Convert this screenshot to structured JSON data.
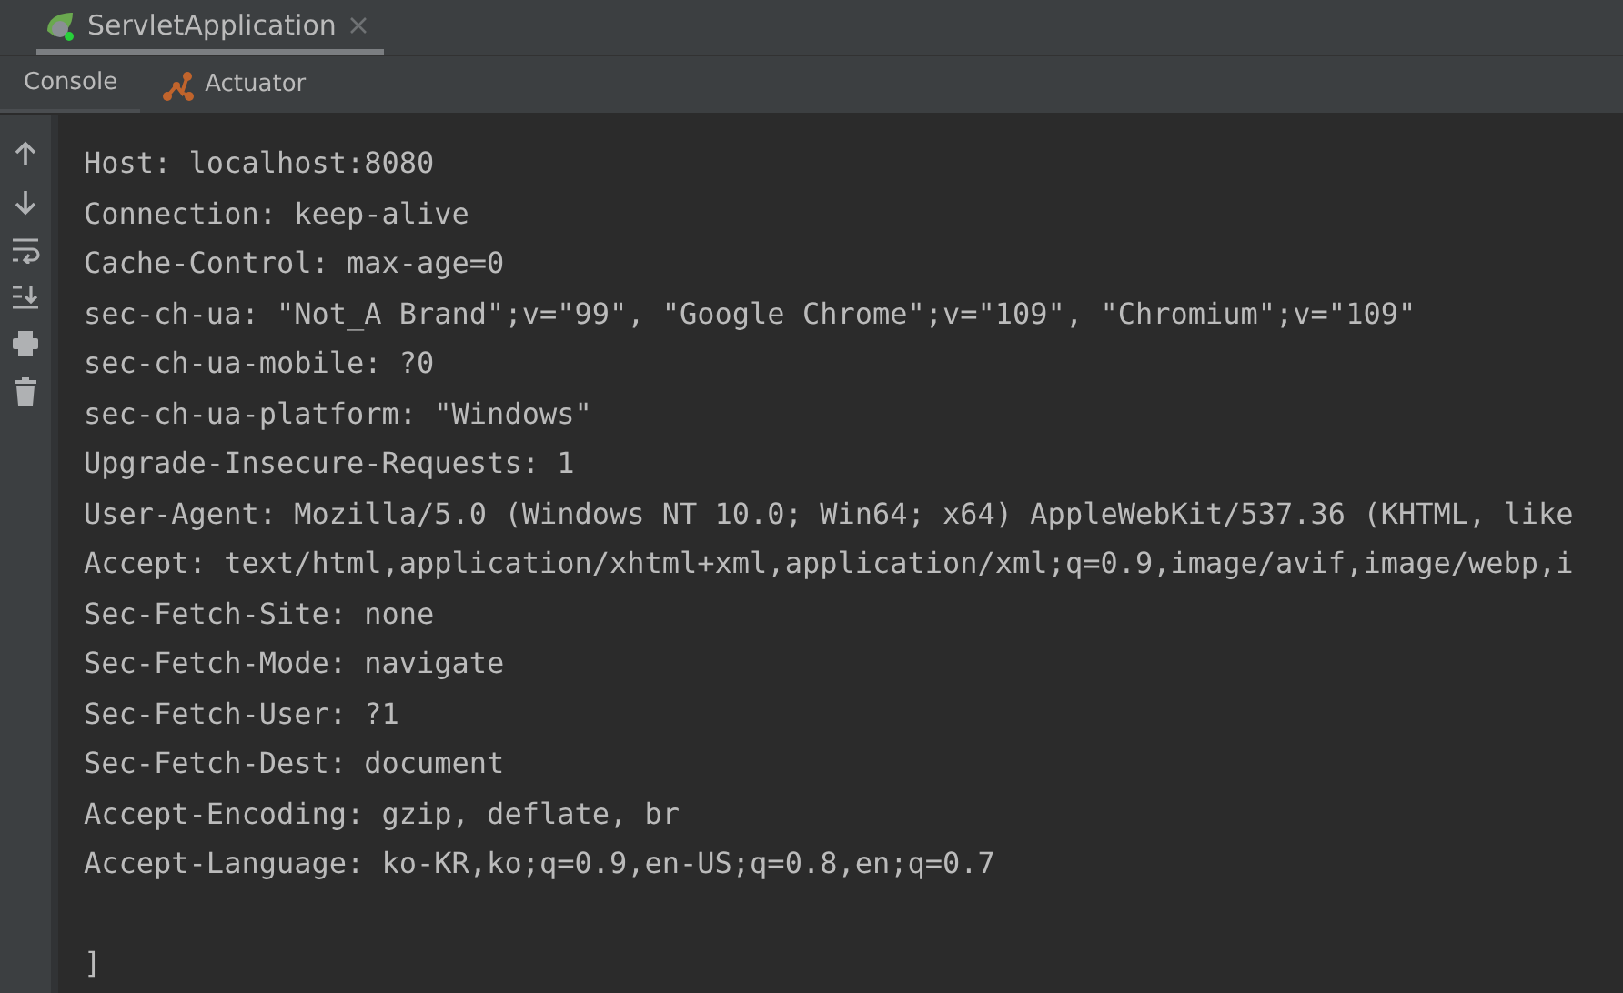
{
  "tabs": [
    {
      "label": "ServletApplication",
      "selected": true
    }
  ],
  "tool_tabs": [
    {
      "label": "Console",
      "selected": true,
      "kind": "console"
    },
    {
      "label": "Actuator",
      "selected": false,
      "kind": "actuator"
    }
  ],
  "toolbar": [
    {
      "kind": "up"
    },
    {
      "kind": "down"
    },
    {
      "kind": "wrap"
    },
    {
      "kind": "scroll-end"
    },
    {
      "kind": "print"
    },
    {
      "kind": "trash"
    }
  ],
  "console_lines": [
    {
      "text": "Host: localhost:8080"
    },
    {
      "text": "Connection: keep-alive"
    },
    {
      "text": "Cache-Control: max-age=0"
    },
    {
      "text": "sec-ch-ua: \"Not_A Brand\";v=\"99\", \"Google Chrome\";v=\"109\", \"Chromium\";v=\"109\""
    },
    {
      "text": "sec-ch-ua-mobile: ?0"
    },
    {
      "text": "sec-ch-ua-platform: \"Windows\""
    },
    {
      "text": "Upgrade-Insecure-Requests: 1"
    },
    {
      "text": "User-Agent: Mozilla/5.0 (Windows NT 10.0; Win64; x64) AppleWebKit/537.36 (KHTML, like"
    },
    {
      "text": "Accept: text/html,application/xhtml+xml,application/xml;q=0.9,image/avif,image/webp,i"
    },
    {
      "text": "Sec-Fetch-Site: none"
    },
    {
      "text": "Sec-Fetch-Mode: navigate"
    },
    {
      "text": "Sec-Fetch-User: ?1"
    },
    {
      "text": "Sec-Fetch-Dest: document"
    },
    {
      "text": "Accept-Encoding: gzip, deflate, br"
    },
    {
      "text": "Accept-Language: ko-KR,ko;q=0.9,en-US;q=0.8,en;q=0.7"
    },
    {
      "text": "]",
      "gap_before": true
    }
  ]
}
